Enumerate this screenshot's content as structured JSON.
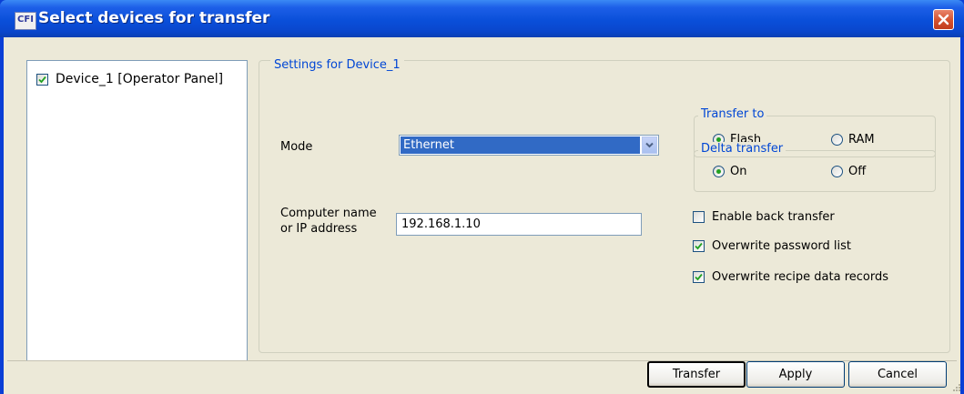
{
  "window": {
    "title": "Select devices for transfer",
    "app_icon_text": "CFI"
  },
  "devices": [
    {
      "label": "Device_1 [Operator Panel]",
      "checked": true
    }
  ],
  "settings": {
    "group_title": "Settings for Device_1",
    "mode_label": "Mode",
    "mode_value": "Ethernet",
    "address_label_line1": "Computer name",
    "address_label_line2": "or IP address",
    "address_value": "192.168.1.10",
    "transfer_to": {
      "title": "Transfer to",
      "options": [
        "Flash",
        "RAM"
      ],
      "selected": "Flash"
    },
    "delta_transfer": {
      "title": "Delta transfer",
      "options": [
        "On",
        "Off"
      ],
      "selected": "On"
    },
    "checkboxes": [
      {
        "label": "Enable back transfer",
        "checked": false
      },
      {
        "label": "Overwrite password list",
        "checked": true
      },
      {
        "label": "Overwrite recipe data records",
        "checked": true
      }
    ]
  },
  "buttons": {
    "transfer": "Transfer",
    "apply": "Apply",
    "cancel": "Cancel"
  },
  "colors": {
    "title_bar": "#0a4fd9",
    "group_title": "#0046d5",
    "selection": "#316ac5",
    "close_button": "#d4512e"
  }
}
